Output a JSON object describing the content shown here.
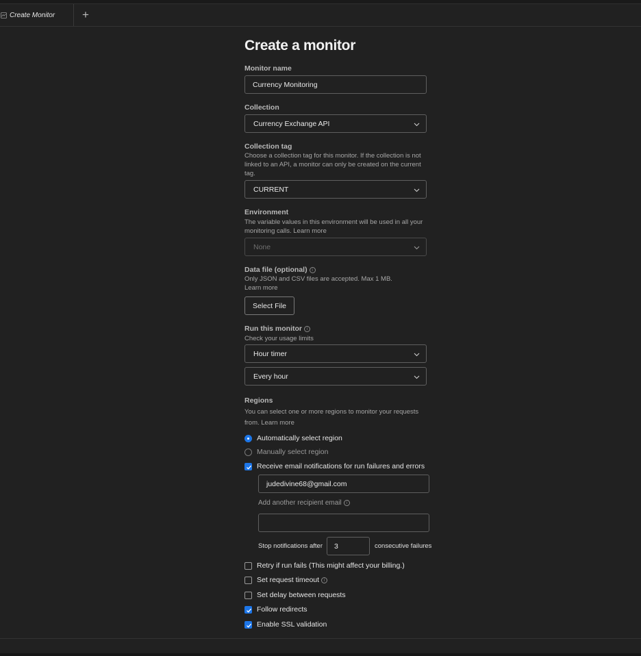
{
  "tab": {
    "title": "Create Monitor",
    "add_label": "+"
  },
  "page": {
    "title": "Create a monitor"
  },
  "monitor_name": {
    "label": "Monitor name",
    "value": "Currency Monitoring"
  },
  "collection": {
    "label": "Collection",
    "value": "Currency Exchange API"
  },
  "collection_tag": {
    "label": "Collection tag",
    "help": "Choose a collection tag for this monitor. If the collection is not linked to an API, a monitor can only be created on the current tag.",
    "value": "CURRENT"
  },
  "environment": {
    "label": "Environment",
    "help": "The variable values in this environment will be used in all your monitoring calls. Learn more",
    "value": "None"
  },
  "data_file": {
    "label": "Data file (optional)",
    "help_line1": "Only JSON and CSV files are accepted. Max 1 MB.",
    "help_line2": "Learn more",
    "button": "Select File"
  },
  "run": {
    "label": "Run this monitor",
    "help": "Check your usage limits",
    "timer_value": "Hour timer",
    "frequency_value": "Every hour"
  },
  "regions": {
    "label": "Regions",
    "help": "You can select one or more regions to monitor your requests from. Learn more",
    "auto_label": "Automatically select region",
    "manual_label": "Manually select region"
  },
  "notifications": {
    "label": "Receive email notifications for run failures and errors",
    "email": "judedivine68@gmail.com",
    "add_recipient_label": "Add another recipient email",
    "add_recipient_value": "",
    "stop_before": "Stop notifications after",
    "stop_value": "3",
    "stop_after": "consecutive failures"
  },
  "options": {
    "retry": "Retry if run fails (This might affect your billing.)",
    "timeout": "Set request timeout",
    "delay": "Set delay between requests",
    "redirects": "Follow redirects",
    "ssl": "Enable SSL validation"
  },
  "colors": {
    "accent": "#1d76e8",
    "background": "#212121"
  }
}
